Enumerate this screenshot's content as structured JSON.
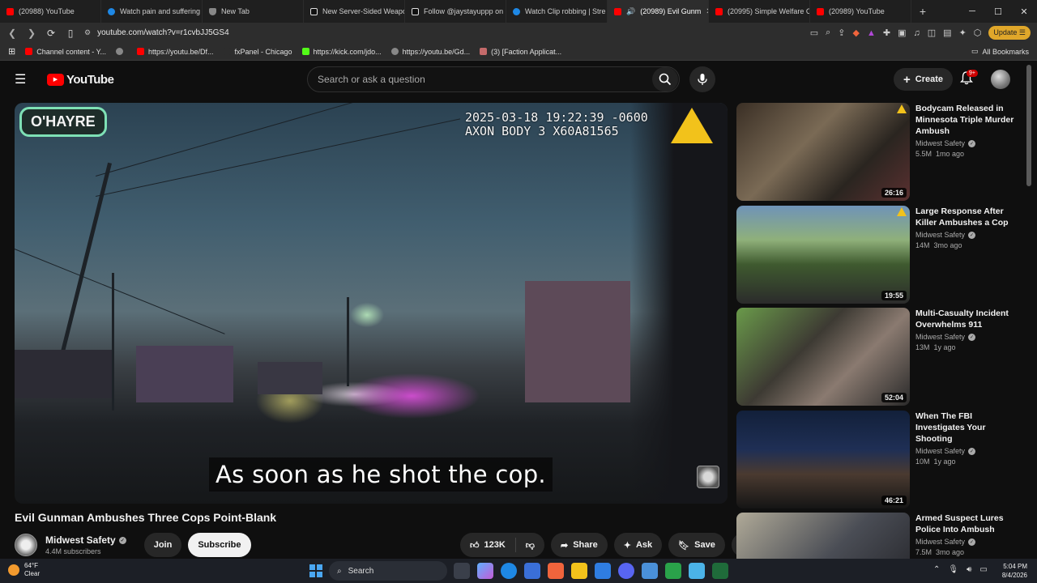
{
  "browser": {
    "tabs": [
      {
        "label": "(20988) YouTube",
        "icon": "youtube-icon",
        "active": false
      },
      {
        "label": "Watch pain and suffering",
        "icon": "edge-icon",
        "active": false
      },
      {
        "label": "New Tab",
        "icon": "shield-icon",
        "active": false
      },
      {
        "label": "New Server-Sided Weapo",
        "icon": "tiktok-icon",
        "active": false
      },
      {
        "label": "Follow @jaystayuppp on",
        "icon": "tiktok-icon",
        "active": false
      },
      {
        "label": "Watch Clip robbing | Stre",
        "icon": "edge-icon",
        "active": false
      },
      {
        "label": "(20989) Evil Gunm",
        "icon": "youtube-icon",
        "active": true
      },
      {
        "label": "(20995) Simple Welfare C",
        "icon": "youtube-icon",
        "active": false
      },
      {
        "label": "(20989) YouTube",
        "icon": "youtube-icon",
        "active": false
      }
    ],
    "url": "youtube.com/watch?v=r1cvbJJ5GS4",
    "update_label": "Update",
    "bookmarks": [
      {
        "label": "Channel content - Y...",
        "icon": "youtube-icon"
      },
      {
        "label": "",
        "icon": "globe-icon"
      },
      {
        "label": "https://youtu.be/Df...",
        "icon": "youtube-icon"
      },
      {
        "label": "fxPanel - Chicago",
        "icon": "globe-icon"
      },
      {
        "label": "https://kick.com/jdo...",
        "icon": "kick-icon"
      },
      {
        "label": "https://youtu.be/Gd...",
        "icon": "globe-icon"
      },
      {
        "label": "(3) [Faction Applicat...",
        "icon": "forum-icon"
      }
    ],
    "all_bookmarks_label": "All Bookmarks"
  },
  "header": {
    "logo_text": "YouTube",
    "search_placeholder": "Search or ask a question",
    "create_label": "Create",
    "notification_count": "9+"
  },
  "video": {
    "brand_tag": "O'HAYRE",
    "axon_line1": "2025-03-18 19:22:39 -0600",
    "axon_line2": "AXON BODY 3 X60A81565",
    "caption": "As soon as he shot the cop.",
    "title": "Evil Gunman Ambushes Three Cops Point-Blank"
  },
  "channel": {
    "name": "Midwest Safety",
    "subscribers": "4.4M subscribers",
    "join_label": "Join",
    "subscribe_label": "Subscribe"
  },
  "actions": {
    "likes": "123K",
    "share_label": "Share",
    "ask_label": "Ask",
    "save_label": "Save"
  },
  "recommendations": [
    {
      "title": "Bodycam Released in Minnesota Triple Murder Ambush",
      "channel": "Midwest Safety",
      "stats": "5.5M views · 1mo ago",
      "views": "5.5M",
      "age": "1mo ago",
      "duration": "26:16",
      "warning": true
    },
    {
      "title": "Large Response After Killer Ambushes a Cop",
      "channel": "Midwest Safety",
      "views": "14M",
      "age": "3mo ago",
      "duration": "19:55",
      "warning": true
    },
    {
      "title": "Multi-Casualty Incident Overwhelms 911",
      "channel": "Midwest Safety",
      "views": "13M",
      "age": "1y ago",
      "duration": "52:04",
      "warning": false
    },
    {
      "title": "When The FBI Investigates Your Shooting",
      "channel": "Midwest Safety",
      "views": "10M",
      "age": "1y ago",
      "duration": "46:21",
      "warning": false
    },
    {
      "title": "Armed Suspect Lures Police Into Ambush",
      "channel": "Midwest Safety",
      "views": "7.5M",
      "age": "3mo ago",
      "duration": "",
      "warning": false
    }
  ],
  "taskbar": {
    "temperature": "64°F",
    "weather": "Clear",
    "search_label": "Search",
    "time": "5:04 PM",
    "date": "8/4/2026"
  }
}
